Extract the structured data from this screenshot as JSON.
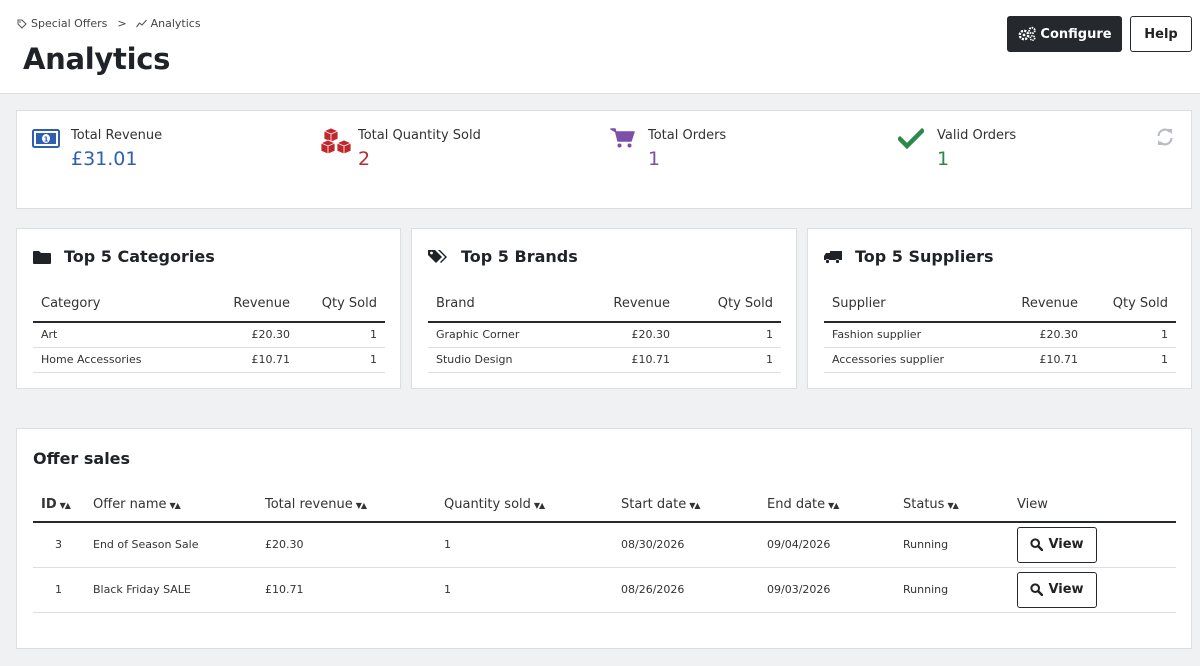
{
  "breadcrumb": {
    "parent": "Special Offers",
    "separator": ">",
    "current": "Analytics"
  },
  "page_title": "Analytics",
  "buttons": {
    "configure": "Configure",
    "help": "Help",
    "view": "View"
  },
  "kpis": {
    "revenue": {
      "label": "Total Revenue",
      "value": "£31.01",
      "color": "#2f5fb3"
    },
    "quantity": {
      "label": "Total Quantity Sold",
      "value": "2",
      "color": "#c0272d"
    },
    "orders": {
      "label": "Total Orders",
      "value": "1",
      "color": "#7d4eaa"
    },
    "valid": {
      "label": "Valid Orders",
      "value": "1",
      "color": "#2b8a4a"
    }
  },
  "top_categories": {
    "title": "Top 5 Categories",
    "headers": [
      "Category",
      "Revenue",
      "Qty Sold"
    ],
    "rows": [
      {
        "name": "Art",
        "revenue": "£20.30",
        "qty": "1"
      },
      {
        "name": "Home Accessories",
        "revenue": "£10.71",
        "qty": "1"
      }
    ]
  },
  "top_brands": {
    "title": "Top 5 Brands",
    "headers": [
      "Brand",
      "Revenue",
      "Qty Sold"
    ],
    "rows": [
      {
        "name": "Graphic Corner",
        "revenue": "£20.30",
        "qty": "1"
      },
      {
        "name": "Studio Design",
        "revenue": "£10.71",
        "qty": "1"
      }
    ]
  },
  "top_suppliers": {
    "title": "Top 5 Suppliers",
    "headers": [
      "Supplier",
      "Revenue",
      "Qty Sold"
    ],
    "rows": [
      {
        "name": "Fashion supplier",
        "revenue": "£20.30",
        "qty": "1"
      },
      {
        "name": "Accessories supplier",
        "revenue": "£10.71",
        "qty": "1"
      }
    ]
  },
  "offer_sales": {
    "title": "Offer sales",
    "headers": [
      "ID",
      "Offer name",
      "Total revenue",
      "Quantity sold",
      "Start date",
      "End date",
      "Status",
      "View"
    ],
    "rows": [
      {
        "id": "3",
        "name": "End of Season Sale",
        "revenue": "£20.30",
        "qty": "1",
        "start": "08/30/2026",
        "end": "09/04/2026",
        "status": "Running"
      },
      {
        "id": "1",
        "name": "Black Friday SALE",
        "revenue": "£10.71",
        "qty": "1",
        "start": "08/26/2026",
        "end": "09/03/2026",
        "status": "Running"
      }
    ]
  }
}
